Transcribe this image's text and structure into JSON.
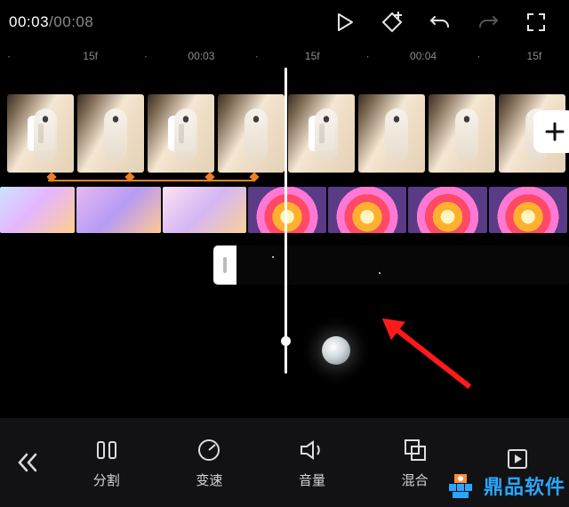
{
  "time": {
    "current": "00:03",
    "total": "00:08",
    "separator": "/"
  },
  "ruler": [
    "15f",
    "00:03",
    "15f",
    "00:04",
    "15f"
  ],
  "toolbar": {
    "back": "返回",
    "items": [
      {
        "id": "split",
        "label": "分割"
      },
      {
        "id": "speed",
        "label": "变速"
      },
      {
        "id": "volume",
        "label": "音量"
      },
      {
        "id": "blend",
        "label": "混合"
      },
      {
        "id": "play",
        "label": ""
      }
    ]
  },
  "icons": {
    "play": "▷",
    "keyframe": "◇+",
    "undo": "↶",
    "redo": "↷",
    "fullscreen": "⛶",
    "add": "＋",
    "chevrons": "«"
  },
  "watermark": "鼎品软件"
}
